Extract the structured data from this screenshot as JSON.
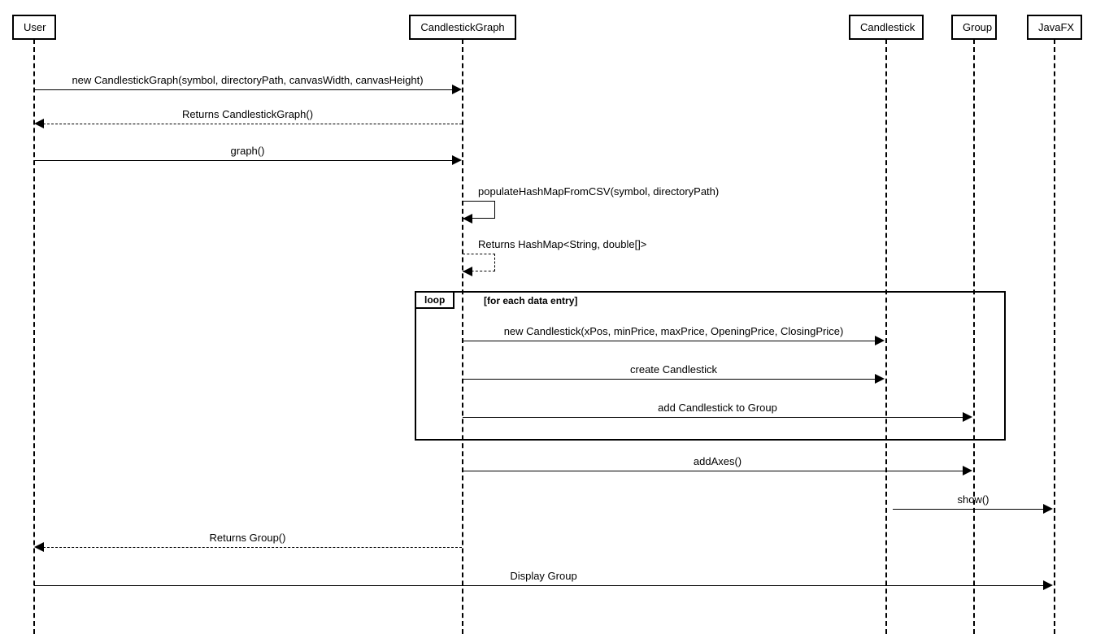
{
  "participants": {
    "user": "User",
    "graph": "CandlestickGraph",
    "candlestick": "Candlestick",
    "group": "Group",
    "javafx": "JavaFX"
  },
  "messages": {
    "m1": "new CandlestickGraph(symbol, directoryPath, canvasWidth, canvasHeight)",
    "m2": "Returns CandlestickGraph()",
    "m3": "graph()",
    "m4": "populateHashMapFromCSV(symbol, directoryPath)",
    "m5": "Returns HashMap<String, double[]>",
    "m6": "new Candlestick(xPos,  minPrice, maxPrice, OpeningPrice, ClosingPrice)",
    "m7": "create Candlestick",
    "m8": "add Candlestick to Group",
    "m9": "addAxes()",
    "m10": "show()",
    "m11": "Returns Group()",
    "m12": "Display Group"
  },
  "loop": {
    "tag": "loop",
    "cond": "[for each data entry]"
  }
}
